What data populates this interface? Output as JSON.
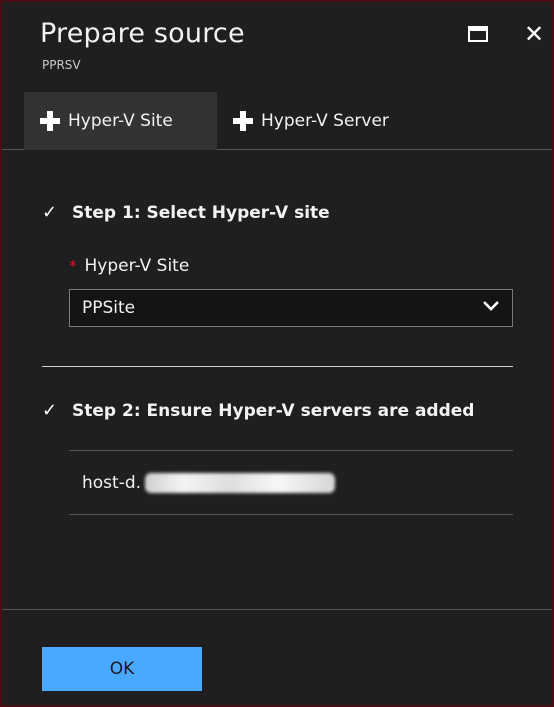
{
  "window": {
    "title": "Prepare source",
    "subtitle": "PPRSV",
    "maximize_icon": "maximize-icon",
    "close_icon": "close-icon",
    "close_glyph": "✕"
  },
  "toolbar": {
    "items": [
      {
        "label": "Hyper-V Site",
        "icon": "plus-icon",
        "active": true
      },
      {
        "label": "Hyper-V Server",
        "icon": "plus-icon",
        "active": false
      }
    ]
  },
  "steps": [
    {
      "label": "Step 1: Select Hyper-V site",
      "icon": "checkmark-icon",
      "glyph": "✓"
    },
    {
      "label": "Step 2: Ensure Hyper-V servers are added",
      "icon": "checkmark-icon",
      "glyph": "✓"
    }
  ],
  "site_field": {
    "required_marker": "*",
    "label": "Hyper-V Site",
    "value": "PPSite"
  },
  "servers": [
    {
      "name_prefix": "host-d."
    }
  ],
  "footer": {
    "ok_label": "OK"
  },
  "colors": {
    "background": "#1f1f1f",
    "accent_button": "#49a8ff",
    "required": "#e81123",
    "active_tab": "#333333"
  }
}
